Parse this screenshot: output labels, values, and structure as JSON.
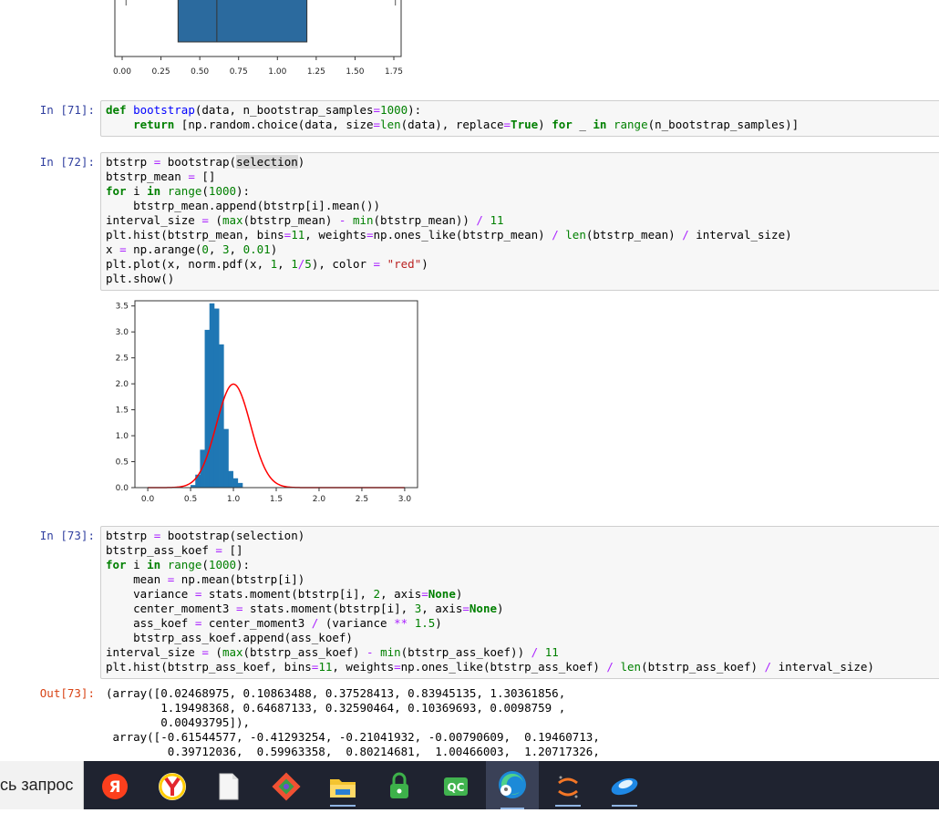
{
  "boxplot": {
    "x_ticks": [
      "0.00",
      "0.25",
      "0.50",
      "0.75",
      "1.00",
      "1.25",
      "1.50",
      "1.75"
    ],
    "box": {
      "q1": 0.36,
      "median": 0.61,
      "q3": 1.19,
      "whisker_low": 0.025,
      "whisker_high": 1.76
    },
    "color": "#2b6a9e"
  },
  "cells": [
    {
      "prompt": "In [71]:"
    },
    {
      "prompt": "In [72]:"
    },
    {
      "prompt": "In [73]:"
    },
    {
      "prompt": "Out[73]:"
    }
  ],
  "code71": [
    "def bootstrap(data, n_bootstrap_samples=1000):",
    "    return [np.random.choice(data, size=len(data), replace=True) for _ in range(n_bootstrap_samples)]"
  ],
  "code72": [
    "btstrp = bootstrap(selection)",
    "btstrp_mean = []",
    "for i in range(1000):",
    "    btstrp_mean.append(btstrp[i].mean())",
    "interval_size = (max(btstrp_mean) - min(btstrp_mean)) / 11",
    "plt.hist(btstrp_mean, bins=11, weights=np.ones_like(btstrp_mean) / len(btstrp_mean) / interval_size)",
    "x = np.arange(0, 3, 0.01)",
    "plt.plot(x, norm.pdf(x, 1, 1/5), color = \"red\")",
    "plt.show()"
  ],
  "code73": [
    "btstrp = bootstrap(selection)",
    "btstrp_ass_koef = []",
    "for i in range(1000):",
    "    mean = np.mean(btstrp[i])",
    "    variance = stats.moment(btstrp[i], 2, axis=None)",
    "    center_moment3 = stats.moment(btstrp[i], 3, axis=None)",
    "    ass_koef = center_moment3 / (variance ** 1.5)",
    "    btstrp_ass_koef.append(ass_koef)",
    "interval_size = (max(btstrp_ass_koef) - min(btstrp_ass_koef)) / 11",
    "plt.hist(btstrp_ass_koef, bins=11, weights=np.ones_like(btstrp_ass_koef) / len(btstrp_ass_koef) / interval_size)"
  ],
  "out73": [
    "(array([0.02468975, 0.10863488, 0.37528413, 0.83945135, 1.30361856,",
    "        1.19498368, 0.64687133, 0.32590464, 0.10369693, 0.0098759 ,",
    "        0.00493795]),",
    " array([-0.61544577, -0.41293254, -0.21041932, -0.00790609,  0.19460713,",
    "         0.39712036,  0.59963358,  0.80214681,  1.00466003,  1.20717326,"
  ],
  "chart_data": {
    "type": "bar",
    "xlim": [
      -0.15,
      3.15
    ],
    "ylim": [
      0,
      3.6
    ],
    "x_ticks": [
      "0.0",
      "0.5",
      "1.0",
      "1.5",
      "2.0",
      "2.5",
      "3.0"
    ],
    "y_ticks": [
      "0.0",
      "0.5",
      "1.0",
      "1.5",
      "2.0",
      "2.5",
      "3.0",
      "3.5"
    ],
    "bins": [
      {
        "left": 0.5,
        "right": 0.555,
        "value": 0.05
      },
      {
        "left": 0.555,
        "right": 0.61,
        "value": 0.25
      },
      {
        "left": 0.61,
        "right": 0.665,
        "value": 0.73
      },
      {
        "left": 0.665,
        "right": 0.72,
        "value": 3.04
      },
      {
        "left": 0.72,
        "right": 0.775,
        "value": 3.55
      },
      {
        "left": 0.775,
        "right": 0.83,
        "value": 3.45
      },
      {
        "left": 0.83,
        "right": 0.885,
        "value": 2.76
      },
      {
        "left": 0.885,
        "right": 0.94,
        "value": 1.13
      },
      {
        "left": 0.94,
        "right": 0.995,
        "value": 0.32
      },
      {
        "left": 0.995,
        "right": 1.05,
        "value": 0.18
      },
      {
        "left": 1.05,
        "right": 1.105,
        "value": 0.09
      }
    ],
    "line": {
      "type": "normal_pdf",
      "mu": 1,
      "sigma": 0.2,
      "x_start": 0,
      "x_end": 3,
      "step": 0.01,
      "color": "red"
    },
    "bar_color": "#1f77b4"
  },
  "taskbar": {
    "search_text": "сь запрос",
    "icons": [
      "yandex-icon",
      "yandex-browser-icon",
      "file-icon",
      "git-icon",
      "file-explorer-icon",
      "vpn-lock-icon",
      "qc-icon",
      "edge-icon",
      "jupyter-icon",
      "app-icon"
    ],
    "qc_label": "QC",
    "yandex_label": "Я"
  }
}
